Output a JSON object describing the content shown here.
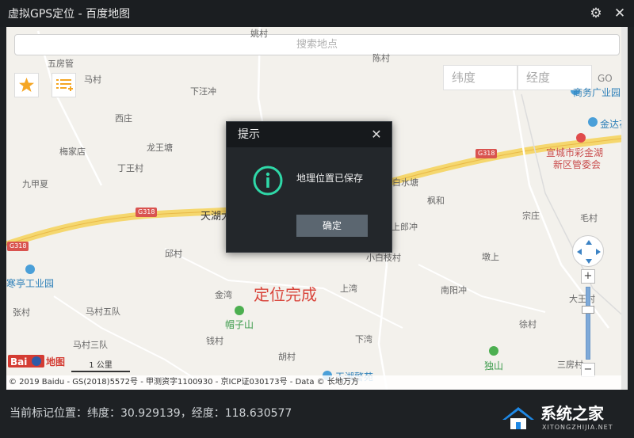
{
  "window": {
    "title": "虚拟GPS定位 - 百度地图",
    "settings_icon": "gear-icon"
  },
  "search": {
    "placeholder": "搜索地点"
  },
  "toolbar": {
    "favorite_icon": "star-icon",
    "list_icon": "list-add-icon"
  },
  "coords_input": {
    "lat_placeholder": "纬度",
    "lng_placeholder": "经度",
    "go_label": "GO"
  },
  "map_labels": [
    {
      "text": "五房管",
      "cls": ""
    },
    {
      "text": "马村",
      "cls": ""
    },
    {
      "text": "下汪冲",
      "cls": ""
    },
    {
      "text": "西庄",
      "cls": ""
    },
    {
      "text": "梅家店",
      "cls": ""
    },
    {
      "text": "龙王塘",
      "cls": ""
    },
    {
      "text": "丁王村",
      "cls": ""
    },
    {
      "text": "九甲夏",
      "cls": ""
    },
    {
      "text": "G318",
      "cls": "road"
    },
    {
      "text": "G318",
      "cls": "road"
    },
    {
      "text": "G318",
      "cls": "road"
    },
    {
      "text": "天湖大",
      "cls": "big"
    },
    {
      "text": "邱村",
      "cls": ""
    },
    {
      "text": "寒亭工业园",
      "cls": "blue"
    },
    {
      "text": "张村",
      "cls": ""
    },
    {
      "text": "马村五队",
      "cls": ""
    },
    {
      "text": "金湾",
      "cls": ""
    },
    {
      "text": "帽子山",
      "cls": "green"
    },
    {
      "text": "上湾",
      "cls": ""
    },
    {
      "text": "马村三队",
      "cls": ""
    },
    {
      "text": "钱村",
      "cls": ""
    },
    {
      "text": "下湾",
      "cls": ""
    },
    {
      "text": "胡村",
      "cls": ""
    },
    {
      "text": "天湖警苑",
      "cls": "blue"
    },
    {
      "text": "白水塘",
      "cls": ""
    },
    {
      "text": "枫和",
      "cls": ""
    },
    {
      "text": "上郎冲",
      "cls": ""
    },
    {
      "text": "小白枝村",
      "cls": ""
    },
    {
      "text": "南阳冲",
      "cls": ""
    },
    {
      "text": "墩上",
      "cls": ""
    },
    {
      "text": "宗庄",
      "cls": ""
    },
    {
      "text": "毛村",
      "cls": ""
    },
    {
      "text": "大王村",
      "cls": ""
    },
    {
      "text": "徐村",
      "cls": ""
    },
    {
      "text": "独山",
      "cls": "green"
    },
    {
      "text": "三房村",
      "cls": ""
    },
    {
      "text": "金达花",
      "cls": "blue"
    },
    {
      "text": "宣城市彩金湖",
      "cls": "poi"
    },
    {
      "text": "新区管委会",
      "cls": "poi"
    },
    {
      "text": "商务广业园",
      "cls": "blue"
    },
    {
      "text": "陈村",
      "cls": ""
    },
    {
      "text": "姚村",
      "cls": ""
    }
  ],
  "map": {
    "status_text": "定位完成",
    "logo_text": "Bai地图",
    "scale_text": "1 公里",
    "copyright": "© 2019 Baidu - GS(2018)5572号 - 甲测资字1100930 - 京ICP证030173号 - Data © 长地万方"
  },
  "dialog": {
    "title": "提示",
    "message": "地理位置已保存",
    "ok_label": "确定",
    "icon": "info-icon"
  },
  "footer": {
    "status": "当前标记位置：纬度：30.929139，经度：118.630577"
  },
  "watermark": {
    "main": "系统之家",
    "sub": "XITONGZHIJIA.NET"
  }
}
